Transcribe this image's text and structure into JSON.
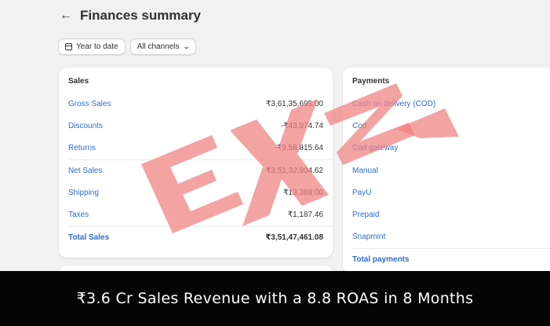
{
  "header": {
    "back_icon": "arrow-left-icon",
    "title": "Finances summary"
  },
  "filters": {
    "date_label": "Year to date",
    "channels_label": "All channels"
  },
  "sales": {
    "title": "Sales",
    "rows": [
      {
        "label": "Gross Sales",
        "value": "₹3,61,35,695.00"
      },
      {
        "label": "Discounts",
        "value": "-₹43,974.74"
      },
      {
        "label": "Returns",
        "value": "-₹9,58,815.64"
      },
      {
        "label": "Net Sales",
        "value": "₹3,51,32,904.62"
      },
      {
        "label": "Shipping",
        "value": "₹13,369.00"
      },
      {
        "label": "Taxes",
        "value": "₹1,187.46"
      }
    ],
    "total": {
      "label": "Total Sales",
      "value": "₹3,51,47,461.08"
    }
  },
  "payments": {
    "title": "Payments",
    "rows": [
      {
        "label": "Cash on delivery (COD)"
      },
      {
        "label": "Cod"
      },
      {
        "label": "Cod gateway"
      },
      {
        "label": "Manual"
      },
      {
        "label": "PayU"
      },
      {
        "label": "Prepaid"
      },
      {
        "label": "Snapmint"
      }
    ],
    "total": {
      "label": "Total payments"
    }
  },
  "watermark": {
    "text": "EXZA",
    "color": "#f08080"
  },
  "banner": {
    "text": "₹3.6 Cr  Sales Revenue with a 8.8 ROAS in 8 Months"
  },
  "colors": {
    "link": "#2c6ecb",
    "background": "#f1f1f1",
    "banner": "#050505"
  }
}
